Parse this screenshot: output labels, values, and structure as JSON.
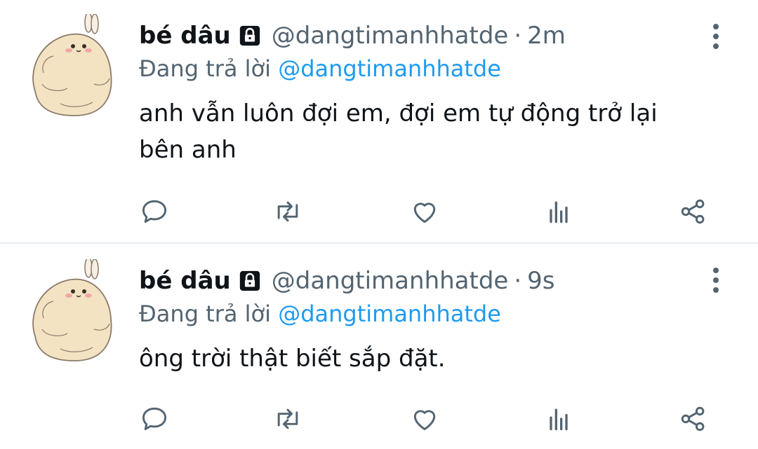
{
  "tweets": [
    {
      "name": "bé dâu",
      "handle": "@dangtimanhhatde",
      "separator": "·",
      "time": "2m",
      "reply_prefix": "Đang trả lời",
      "reply_to": "@dangtimanhhatde",
      "text": "anh vẫn luôn đợi em, đợi em tự động trở lại bên anh",
      "icons": [
        "reply-icon",
        "retweet-icon",
        "like-icon",
        "analytics-icon",
        "share-icon",
        "more-icon",
        "lock-icon"
      ]
    },
    {
      "name": "bé dâu",
      "handle": "@dangtimanhhatde",
      "separator": "·",
      "time": "9s",
      "reply_prefix": "Đang trả lời",
      "reply_to": "@dangtimanhhatde",
      "text": "ông trời thật biết sắp đặt.",
      "icons": [
        "reply-icon",
        "retweet-icon",
        "like-icon",
        "analytics-icon",
        "share-icon",
        "more-icon",
        "lock-icon"
      ]
    }
  ],
  "colors": {
    "text": "#0f1419",
    "secondary": "#536471",
    "link": "#1d9bf0",
    "divider": "#e6ecf0"
  }
}
